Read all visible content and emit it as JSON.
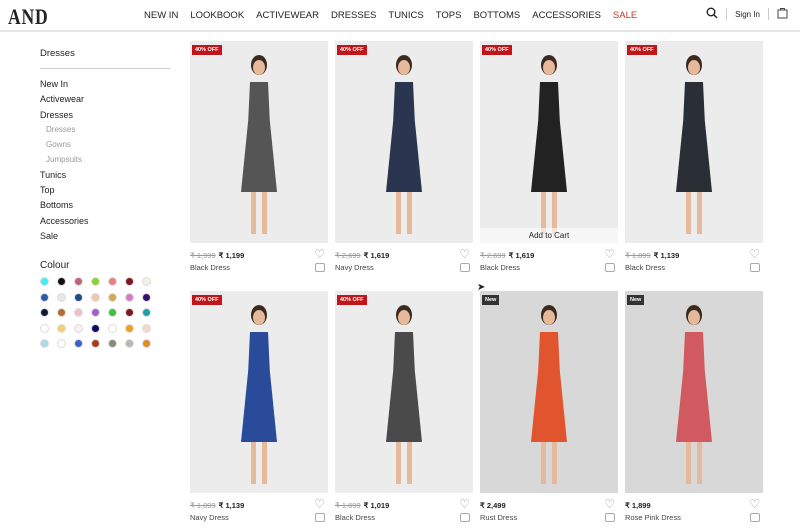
{
  "header": {
    "logo": "AND",
    "nav": [
      "NEW IN",
      "LOOKBOOK",
      "ACTIVEWEAR",
      "DRESSES",
      "TUNICS",
      "TOPS",
      "BOTTOMS",
      "ACCESSORIES",
      "SALE"
    ],
    "sign_in": "Sign In"
  },
  "sidebar": {
    "title": "Dresses",
    "items": [
      "New In",
      "Activewear",
      "Dresses"
    ],
    "sub_items": [
      "Dresses",
      "Gowns",
      "Jumpsuits"
    ],
    "items_after": [
      "Tunics",
      "Top",
      "Bottoms",
      "Accessories",
      "Sale"
    ],
    "colour_title": "Colour",
    "colours": [
      "#3ff0f5",
      "#111111",
      "#c0607a",
      "#8fcf3a",
      "#e88080",
      "#7a1a20",
      "#f3f0e6",
      "#2b5aa8",
      "#e8e8e4",
      "#1f4a8a",
      "#f0c8b0",
      "#d4a850",
      "#d080c0",
      "#3a1070",
      "#111a30",
      "#b86a30",
      "#f0c0c8",
      "#a060d0",
      "#40c040",
      "#7a1a20",
      "#20a0a0",
      "#ffffff",
      "#f5d070",
      "#f2f2f2",
      "#0a0a6a",
      "#ffffff",
      "#f0a020",
      "#f5d8cc",
      "#a8dce8",
      "#ffffff",
      "#3a60d0",
      "#a04020",
      "#8a8a78",
      "#b8b8b8",
      "#e08a20"
    ]
  },
  "products": [
    {
      "badge": "40% OFF",
      "old_price": "₹ 1,999",
      "price": "₹ 1,199",
      "name": "Black Dress",
      "dress": "#555"
    },
    {
      "badge": "40% OFF",
      "old_price": "₹ 2,699",
      "price": "₹ 1,619",
      "name": "Navy Dress",
      "dress": "#2a3550"
    },
    {
      "badge": "40% OFF",
      "old_price": "₹ 2,699",
      "price": "₹ 1,619",
      "name": "Black Dress",
      "dress": "#222",
      "add_to_cart": "Add to Cart"
    },
    {
      "badge": "40% OFF",
      "old_price": "₹ 1,899",
      "price": "₹ 1,139",
      "name": "Black Dress",
      "dress": "#2a2e35"
    },
    {
      "badge": "40% OFF",
      "old_price": "₹ 1,899",
      "price": "₹ 1,139",
      "name": "Navy Dress",
      "dress": "#2a4a9a"
    },
    {
      "badge": "40% OFF",
      "old_price": "₹ 1,699",
      "price": "₹ 1,019",
      "name": "Black Dress",
      "dress": "#4a4a4a"
    },
    {
      "badge": "New",
      "old_price": "",
      "price": "₹ 2,499",
      "name": "Rust Dress",
      "dress": "#e0552e"
    },
    {
      "badge": "New",
      "old_price": "",
      "price": "₹ 1,899",
      "name": "Rose Pink Dress",
      "dress": "#d05a60"
    }
  ]
}
